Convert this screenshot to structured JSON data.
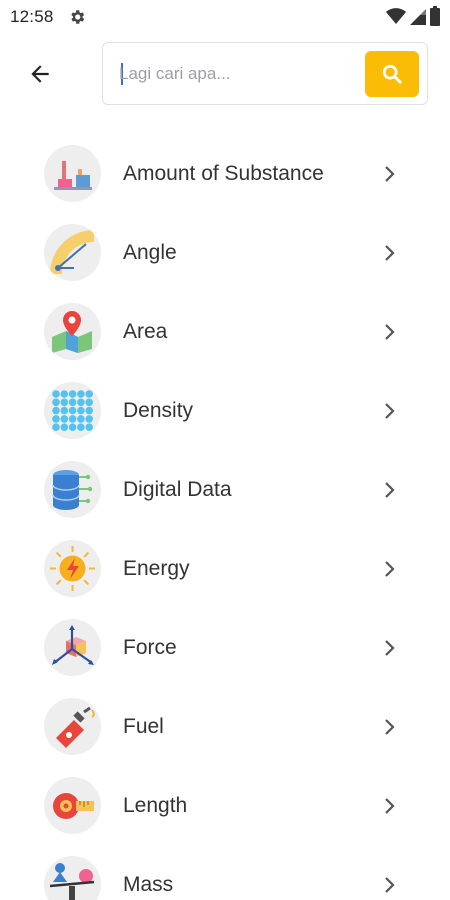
{
  "status_bar": {
    "time": "12:58"
  },
  "search": {
    "placeholder": "Lagi cari apa..."
  },
  "categories": [
    {
      "label": "Amount of Substance",
      "icon": "amount-of-substance-icon"
    },
    {
      "label": "Angle",
      "icon": "angle-icon"
    },
    {
      "label": "Area",
      "icon": "area-icon"
    },
    {
      "label": "Density",
      "icon": "density-icon"
    },
    {
      "label": "Digital Data",
      "icon": "digital-data-icon"
    },
    {
      "label": "Energy",
      "icon": "energy-icon"
    },
    {
      "label": "Force",
      "icon": "force-icon"
    },
    {
      "label": "Fuel",
      "icon": "fuel-icon"
    },
    {
      "label": "Length",
      "icon": "length-icon"
    },
    {
      "label": "Mass",
      "icon": "mass-icon"
    }
  ],
  "colors": {
    "accent": "#fbbc05",
    "text": "#333333",
    "icon_bg": "#eeeeee"
  }
}
